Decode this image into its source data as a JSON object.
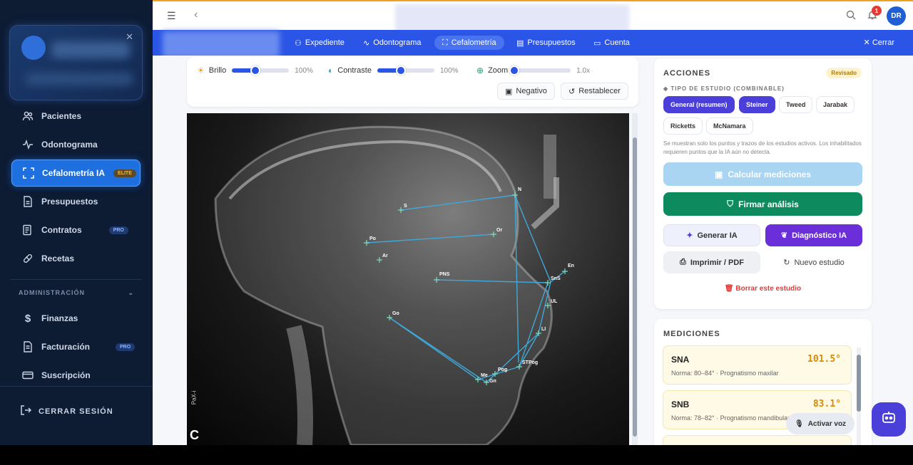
{
  "sidebar": {
    "nav": [
      {
        "label": "Pacientes",
        "icon": "users-icon"
      },
      {
        "label": "Odontograma",
        "icon": "activity-icon"
      },
      {
        "label": "Cefalometría IA",
        "icon": "scan-icon",
        "badge": "ELITE",
        "active": true
      },
      {
        "label": "Presupuestos",
        "icon": "document-icon"
      },
      {
        "label": "Contratos",
        "icon": "contract-icon",
        "badge": "PRO"
      },
      {
        "label": "Recetas",
        "icon": "pill-icon"
      }
    ],
    "admin_heading": "ADMINISTRACIÓN",
    "admin_nav": [
      {
        "label": "Finanzas",
        "icon": "dollar-icon"
      },
      {
        "label": "Facturación",
        "icon": "invoice-icon",
        "badge": "PRO"
      },
      {
        "label": "Suscripción",
        "icon": "card-icon"
      }
    ],
    "logout": "CERRAR SESIÓN"
  },
  "topbar": {
    "notifications": "1",
    "user_initials": "DR"
  },
  "tabs": [
    {
      "label": "Expediente",
      "icon": "user-icon"
    },
    {
      "label": "Odontograma",
      "icon": "activity-icon"
    },
    {
      "label": "Cefalometría",
      "icon": "scan-icon",
      "active": true
    },
    {
      "label": "Presupuestos",
      "icon": "document-icon"
    },
    {
      "label": "Cuenta",
      "icon": "wallet-icon"
    }
  ],
  "tabbar_close": "Cerrar",
  "controls": {
    "brightness": {
      "label": "Brillo",
      "value": "100%",
      "level": 0.4
    },
    "contrast": {
      "label": "Contraste",
      "value": "100%",
      "level": 0.4
    },
    "zoom": {
      "label": "Zoom",
      "value": "1.0x",
      "level": 0.0
    },
    "negative": "Negativo",
    "reset": "Restablecer"
  },
  "xray": {
    "corner_label": "C",
    "device_label": "PaX-i",
    "landmarks": [
      "S",
      "N",
      "Po",
      "Or",
      "Ar",
      "PNS",
      "SnS",
      "En",
      "Go",
      "UL",
      "LI",
      "STPog",
      "Me",
      "Pog",
      "Gn"
    ]
  },
  "acciones": {
    "title": "ACCIONES",
    "status": "Revisado",
    "study_type_heading": "TIPO DE ESTUDIO (COMBINABLE)",
    "study_types": [
      {
        "label": "General (resumen)",
        "on": true
      },
      {
        "label": "Steiner",
        "on": true
      },
      {
        "label": "Tweed",
        "on": false
      },
      {
        "label": "Jarabak",
        "on": false
      },
      {
        "label": "Ricketts",
        "on": false
      },
      {
        "label": "McNamara",
        "on": false
      }
    ],
    "note": "Se muestran solo los puntos y trazos de los estudios activos. Los inhabilitados requieren puntos que la IA aún no detecta.",
    "calc": "Calcular mediciones",
    "sign": "Firmar análisis",
    "generate_ai": "Generar IA",
    "diagnosis_ai": "Diagnóstico IA",
    "print": "Imprimir / PDF",
    "new_study": "Nuevo estudio",
    "delete": "Borrar este estudio"
  },
  "mediciones": {
    "title": "MEDICIONES",
    "items": [
      {
        "name": "SNA",
        "value": "101.5°",
        "norm": "Norma: 80–84° · Prognatismo maxilar"
      },
      {
        "name": "SNB",
        "value": "83.1°",
        "norm": "Norma: 78–82° · Prognatismo mandibular"
      }
    ]
  },
  "voice": "Activar voz",
  "colors": {
    "primary": "#2b55e6",
    "sidebar": "#0d1b33",
    "success": "#0e8a5f",
    "violet": "#4a3fd8",
    "danger": "#e53935",
    "amber": "#d88a00"
  }
}
